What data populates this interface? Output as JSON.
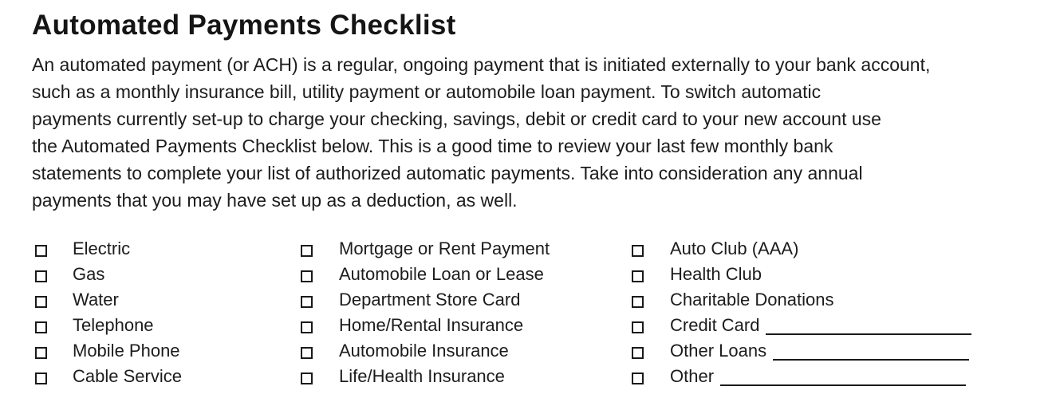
{
  "document": {
    "title": "Automated Payments Checklist",
    "intro_lines": [
      "An automated payment (or ACH) is a regular, ongoing payment that is initiated externally to your bank account,",
      "such as a monthly insurance bill, utility payment or automobile loan payment. To switch automatic",
      "payments currently set-up to charge your checking, savings, debit or credit card to your new account use",
      "the Automated Payments Checklist below.  This is a good time to review your last few monthly bank",
      "statements to complete your list of authorized automatic payments.  Take into consideration any annual",
      "payments that you may have set up as a deduction, as well."
    ]
  },
  "checklist": {
    "columns": [
      {
        "items": [
          {
            "label": "Electric",
            "checked": false
          },
          {
            "label": "Gas",
            "checked": false
          },
          {
            "label": "Water",
            "checked": false
          },
          {
            "label": "Telephone",
            "checked": false
          },
          {
            "label": "Mobile Phone",
            "checked": false
          },
          {
            "label": "Cable Service",
            "checked": false
          }
        ]
      },
      {
        "items": [
          {
            "label": "Mortgage or Rent Payment",
            "checked": false
          },
          {
            "label": "Automobile Loan or Lease",
            "checked": false
          },
          {
            "label": "Department Store Card",
            "checked": false
          },
          {
            "label": "Home/Rental Insurance",
            "checked": false
          },
          {
            "label": "Automobile Insurance",
            "checked": false
          },
          {
            "label": "Life/Health Insurance",
            "checked": false
          }
        ]
      },
      {
        "items": [
          {
            "label": "Auto Club (AAA)",
            "checked": false
          },
          {
            "label": "Health Club",
            "checked": false
          },
          {
            "label": "Charitable Donations",
            "checked": false
          },
          {
            "label": "Credit Card",
            "checked": false,
            "fill_in": ""
          },
          {
            "label": "Other Loans",
            "checked": false,
            "fill_in": ""
          },
          {
            "label": "Other",
            "checked": false,
            "fill_in": ""
          }
        ]
      }
    ]
  }
}
